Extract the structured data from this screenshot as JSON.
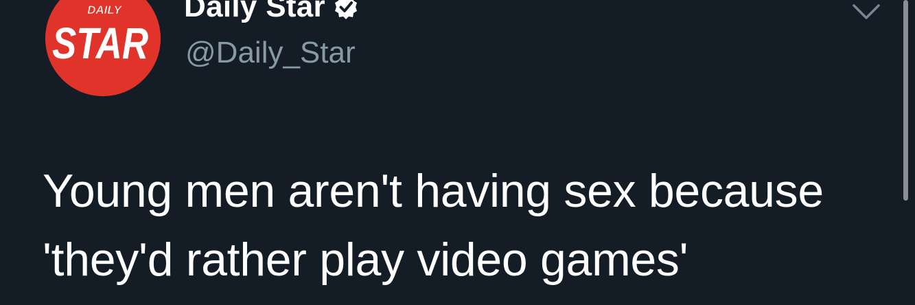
{
  "tweet": {
    "author": {
      "display_name": "Daily Star",
      "handle": "@Daily_Star",
      "verified": true,
      "avatar": {
        "icon": "daily-star-logo",
        "logo_small_text": "DAILY",
        "logo_big_text": "STAR",
        "background_color": "#e0342a"
      }
    },
    "text_lines": [
      "Young men aren't having sex because",
      "'they'd rather play video games'"
    ],
    "menu_icon": "chevron-down-icon"
  },
  "theme": {
    "background": "#141d26",
    "text_primary": "#ffffff",
    "text_secondary": "#8899a6"
  }
}
